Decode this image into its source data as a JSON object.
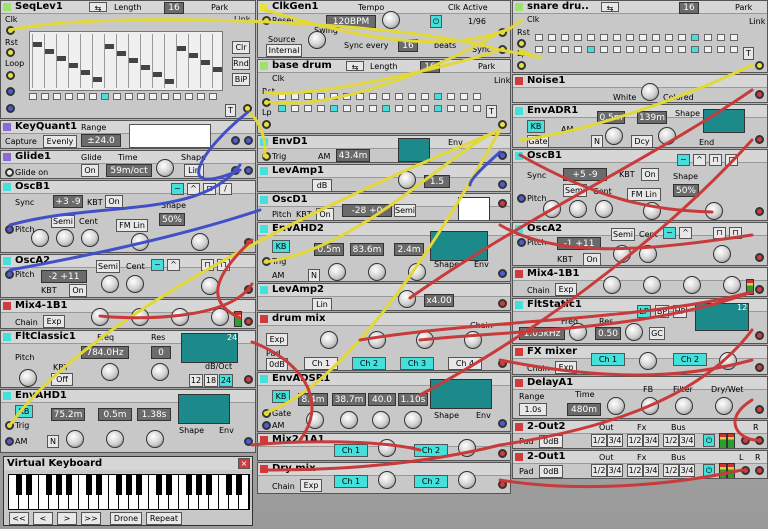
{
  "modules": {
    "seqlev": {
      "title": "SeqLev1",
      "length_label": "Length",
      "length": "16",
      "clk": "Clk",
      "rst": "Rst",
      "loop": "Loop",
      "park": "Park",
      "link": "Link",
      "clr": "Clr",
      "rnd": "Rnd",
      "bip": "BiP",
      "t": "T"
    },
    "clkgen": {
      "title": "ClkGen1",
      "tempo_label": "Tempo",
      "tempo": "120BPM",
      "clk_active": "Clk Active",
      "div": "1/96",
      "reset": "Reset",
      "swing": "Swing",
      "source_label": "Source",
      "source": "Internal",
      "sync_label": "Sync every",
      "sync": "16",
      "beats": "beats",
      "sync2": "Sync"
    },
    "snare": {
      "title": "snare dru..",
      "length": "16",
      "clk": "Clk",
      "rst": "Rst",
      "lp": "Lp",
      "park": "Park",
      "link": "Link",
      "t": "T"
    },
    "basedrum": {
      "title": "base drum",
      "length_label": "Length",
      "length": "16",
      "clk": "Clk",
      "rst": "Rst",
      "lp": "Lp",
      "park": "Park",
      "link": "Link",
      "t": "T"
    },
    "noise": {
      "title": "Noise1",
      "white": "White",
      "colored": "Colored"
    },
    "envadr": {
      "title": "EnvADR1",
      "kb": "KB",
      "am": "AM",
      "a": "0.5m",
      "d": "139m",
      "shape": "Shape",
      "gate": "Gate",
      "n": "N",
      "dcy": "Dcy",
      "endf": "End"
    },
    "keyquant": {
      "title": "KeyQuant1",
      "range_label": "Range",
      "range": "±24.0",
      "capture": "Capture",
      "capture_val": "Evenly"
    },
    "envd": {
      "title": "EnvD1",
      "trig": "Trig",
      "am": "AM",
      "time": "43.4m",
      "env": "Env"
    },
    "glide": {
      "title": "Glide1",
      "glide_on": "Glide on",
      "glide": "Glide",
      "glide_val": "On",
      "time_label": "Time",
      "time": "59m/oct",
      "shape": "Shape",
      "shape_val": "Lin"
    },
    "levamp1": {
      "title": "LevAmp1",
      "db": "dB",
      "val": "1.5"
    },
    "oscb1_right": {
      "title": "OscB1",
      "sync": "Sync",
      "semi": "+5",
      "cent": "-9",
      "kbt": "KBT",
      "kbt_val": "On",
      "pitch": "Pitch",
      "semi_btn": "Semi",
      "cent_label": "Cent",
      "fm_lin": "FM Lin",
      "shape": "Shape",
      "shape_val": "50%"
    },
    "oscb1": {
      "title": "OscB1",
      "sync": "Sync",
      "semi": "+3",
      "cent": "-9",
      "kbt": "KBT",
      "kbt_val": "On",
      "pitch": "Pitch",
      "semi_btn": "Semi",
      "cent_label": "Cent",
      "fm_lin": "FM Lin",
      "shape": "Shape",
      "shape_val": "50%"
    },
    "oscd": {
      "title": "OscD1",
      "pitch": "Pitch",
      "kbt": "KBT",
      "kbt_val": "On",
      "semi": "-28",
      "cent": "+0",
      "semi_btn": "Semi"
    },
    "osca2_right": {
      "title": "OscA2",
      "pitch": "Pitch",
      "semi_btn": "Semi",
      "cent_label": "Cent",
      "semi": "-1",
      "cent": "+11",
      "kbt": "KBT",
      "kbt_val": "On"
    },
    "osca2": {
      "title": "OscA2",
      "pitch": "Pitch",
      "semi_btn": "Semi",
      "cent_label": "Cent",
      "semi": "-2",
      "cent": "+11",
      "kbt": "KBT",
      "kbt_val": "On"
    },
    "envahd2": {
      "title": "EnvAHD2",
      "kb": "KB",
      "a": "0.5m",
      "h": "83.6m",
      "d": "2.4m",
      "trig": "Trig",
      "am": "AM",
      "n": "N",
      "shape": "Shape",
      "env": "Env"
    },
    "mix41b1_right": {
      "title": "Mix4-1B1",
      "chain": "Chain",
      "exp": "Exp"
    },
    "mix41b1": {
      "title": "Mix4-1B1",
      "chain": "Chain",
      "exp": "Exp"
    },
    "levamp2": {
      "title": "LevAmp2",
      "lin": "Lin",
      "val": "x4.00"
    },
    "fltstatic": {
      "title": "FltStatic1",
      "freq_label": "Freq",
      "freq": "1.05kHz",
      "res_label": "Res",
      "res": "0.50",
      "lp": "LP",
      "bp": "BP",
      "hp": "HP",
      "gc": "GC",
      "db": "12"
    },
    "drummix": {
      "title": "drum mix",
      "chain": "Chain",
      "exp": "Exp",
      "pad": "Pad",
      "pad_val": "0dB",
      "ch": [
        "Ch 1",
        "Ch 2",
        "Ch 3",
        "Ch 4"
      ]
    },
    "fltclassic": {
      "title": "FltClassic1",
      "freq_label": "Freq",
      "freq": "784.0Hz",
      "res_label": "Res",
      "res": "0",
      "pitch": "Pitch",
      "kbt": "KBT",
      "kbt_val": "Off",
      "dboct": "dB/Oct",
      "slopes": [
        "12",
        "18",
        "24"
      ],
      "db": "24"
    },
    "fxmixer": {
      "title": "FX mixer",
      "chain": "Chain",
      "exp": "Exp",
      "ch1": "Ch 1",
      "ch2": "Ch 2"
    },
    "envadsr": {
      "title": "EnvADSR1",
      "kb": "KB",
      "a": "8.4m",
      "d": "38.7m",
      "s": "40.0",
      "r": "1.10s",
      "gate": "Gate",
      "am": "AM",
      "shape": "Shape",
      "env": "Env",
      "n": "N"
    },
    "delay": {
      "title": "DelayA1",
      "range_label": "Range",
      "range": "1.0s",
      "time_label": "Time",
      "time": "480m",
      "fb": "FB",
      "filter": "Filter",
      "drywet": "Dry/Wet"
    },
    "envahd1": {
      "title": "EnvAHD1",
      "kb": "KB",
      "a": "75.2m",
      "h": "0.5m",
      "d": "1.38s",
      "trig": "Trig",
      "am": "AM",
      "n": "N",
      "shape": "Shape",
      "env": "Env"
    },
    "mix21a1": {
      "title": "Mix2-1A1",
      "ch1": "Ch 1",
      "ch2": "Ch 2"
    },
    "out2a": {
      "title": "2-Out2",
      "pad": "Pad",
      "pad_val": "0dB",
      "out": "Out",
      "fx": "Fx",
      "bus": "Bus",
      "out_opts": [
        "1/2",
        "3/4"
      ],
      "fx_opts": [
        "1/2",
        "3/4"
      ],
      "bus_opts": [
        "1/2",
        "3/4"
      ],
      "l": "L",
      "r": "R"
    },
    "drymix": {
      "title": "Dry mix",
      "chain": "Chain",
      "exp": "Exp",
      "ch1": "Ch 1",
      "ch2": "Ch 2"
    },
    "out1": {
      "title": "2-Out1",
      "pad": "Pad",
      "pad_val": "0dB",
      "out": "Out",
      "fx": "Fx",
      "bus": "Bus",
      "out_opts": [
        "1/2",
        "3/4"
      ],
      "fx_opts": [
        "1/2",
        "3/4"
      ],
      "bus_opts": [
        "1/2",
        "3/4"
      ],
      "l": "L",
      "r": "R"
    }
  },
  "keyboard": {
    "title": "Virtual Keyboard",
    "close": "×",
    "prev_prev": "<<",
    "prev": "<",
    "next": ">",
    "next_next": ">>",
    "drone": "Drone",
    "repeat": "Repeat"
  },
  "colors": {
    "cable_yellow": "#e3d83a",
    "cable_red": "#c93a3a",
    "cable_blue": "#4250c8",
    "accent": "#43e0dc"
  }
}
